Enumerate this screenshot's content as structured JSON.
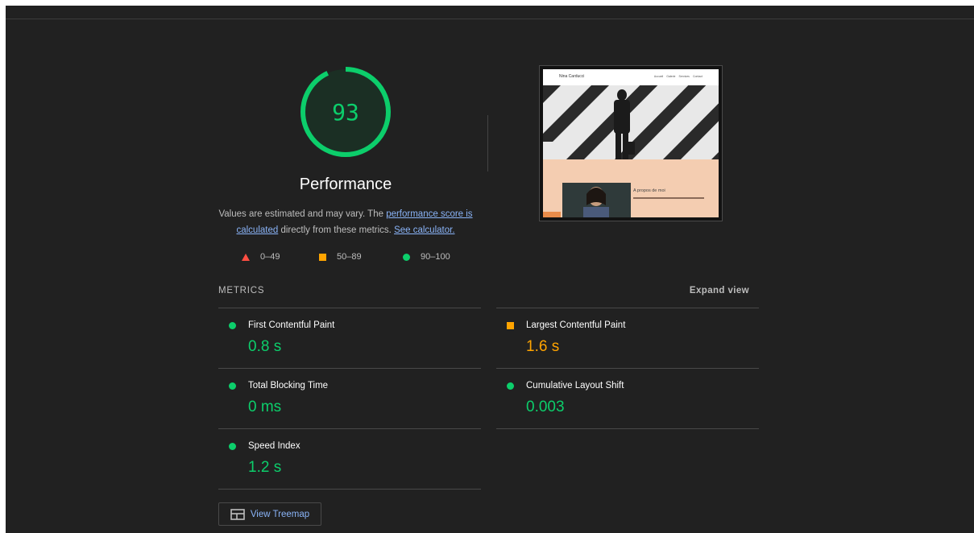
{
  "performance": {
    "score": "93",
    "score_fraction": 0.93,
    "category_title": "Performance",
    "description_prefix": "Values are estimated and may vary. The ",
    "score_link": "performance score is calculated",
    "description_mid": " directly from these metrics. ",
    "calculator_link": "See calculator.",
    "legend": [
      {
        "range": "0–49",
        "icon": "red-triangle-icon"
      },
      {
        "range": "50–89",
        "icon": "orange-square-icon"
      },
      {
        "range": "90–100",
        "icon": "green-circle-icon"
      }
    ]
  },
  "thumbnail": {
    "site_name": "Nina Carducci",
    "nav_links": [
      "Accueil",
      "Galerie",
      "Services",
      "Contact"
    ],
    "about_heading": "A propos de moi"
  },
  "metrics": {
    "heading": "METRICS",
    "expand_label": "Expand view",
    "items": [
      {
        "name": "First Contentful Paint",
        "value": "0.8 s",
        "status": "pass"
      },
      {
        "name": "Largest Contentful Paint",
        "value": "1.6 s",
        "status": "average"
      },
      {
        "name": "Total Blocking Time",
        "value": "0 ms",
        "status": "pass"
      },
      {
        "name": "Cumulative Layout Shift",
        "value": "0.003",
        "status": "pass"
      },
      {
        "name": "Speed Index",
        "value": "1.2 s",
        "status": "pass"
      }
    ]
  },
  "treemap_button": {
    "label": "View Treemap",
    "icon": "treemap-icon"
  },
  "colors": {
    "pass": "#0cce6b",
    "average": "#ffa400",
    "fail": "#ff4e42",
    "link": "#8ab4f8",
    "background": "#212121"
  }
}
